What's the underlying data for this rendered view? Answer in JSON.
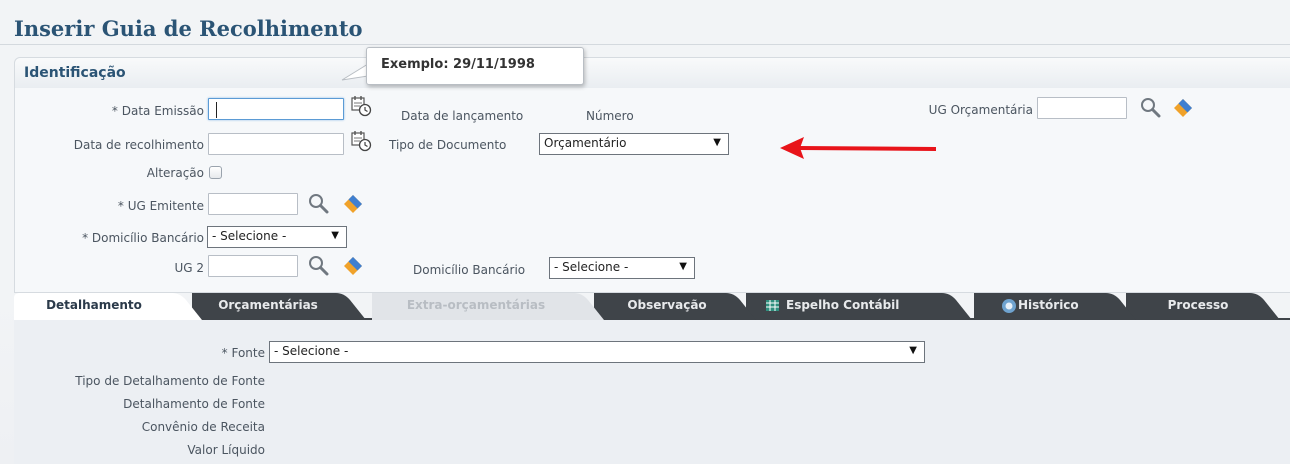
{
  "page": {
    "title": "Inserir Guia de Recolhimento"
  },
  "tooltip": {
    "text": "Exemplo: 29/11/1998"
  },
  "identificacao": {
    "title": "Identificação",
    "data_emissao": {
      "label": "* Data Emissão",
      "value": ""
    },
    "data_recolhimento": {
      "label": "Data de recolhimento",
      "value": ""
    },
    "alteracao": {
      "label": "Alteração",
      "checked": false
    },
    "ug_emitente": {
      "label": "* UG Emitente",
      "value": ""
    },
    "domicilio_bancario_1": {
      "label": "* Domicílio Bancário",
      "value": "- Selecione -"
    },
    "ug2": {
      "label": "UG 2",
      "value": ""
    },
    "data_lancamento": {
      "label": "Data de lançamento"
    },
    "numero": {
      "label": "Número"
    },
    "tipo_documento": {
      "label": "Tipo de Documento",
      "value": "Orçamentário"
    },
    "domicilio_bancario_2": {
      "label": "Domicílio Bancário",
      "value": "- Selecione -"
    },
    "ug_orcamentaria": {
      "label": "UG Orçamentária",
      "value": ""
    }
  },
  "tabs": [
    {
      "label": "Detalhamento",
      "state": "active"
    },
    {
      "label": "Orçamentárias",
      "state": "normal"
    },
    {
      "label": "Extra-orçamentárias",
      "state": "disabled"
    },
    {
      "label": "Observação",
      "state": "normal"
    },
    {
      "label": "Espelho Contábil",
      "state": "normal",
      "icon": "table-icon"
    },
    {
      "label": "Histórico",
      "state": "normal",
      "icon": "history-icon"
    },
    {
      "label": "Processo",
      "state": "normal"
    }
  ],
  "detalhamento": {
    "fonte": {
      "label": "* Fonte",
      "value": "- Selecione -"
    },
    "tipo_detalhamento_fonte": {
      "label": "Tipo de Detalhamento de Fonte"
    },
    "detalhamento_fonte": {
      "label": "Detalhamento de Fonte"
    },
    "convenio_receita": {
      "label": "Convênio de Receita"
    },
    "valor_liquido": {
      "label": "Valor Líquido"
    }
  },
  "annotation": {
    "arrow_color": "#e8141a"
  },
  "colors": {
    "title": "#2b5475",
    "dark_tab": "#3f4449",
    "active_tab": "#ffffff"
  }
}
